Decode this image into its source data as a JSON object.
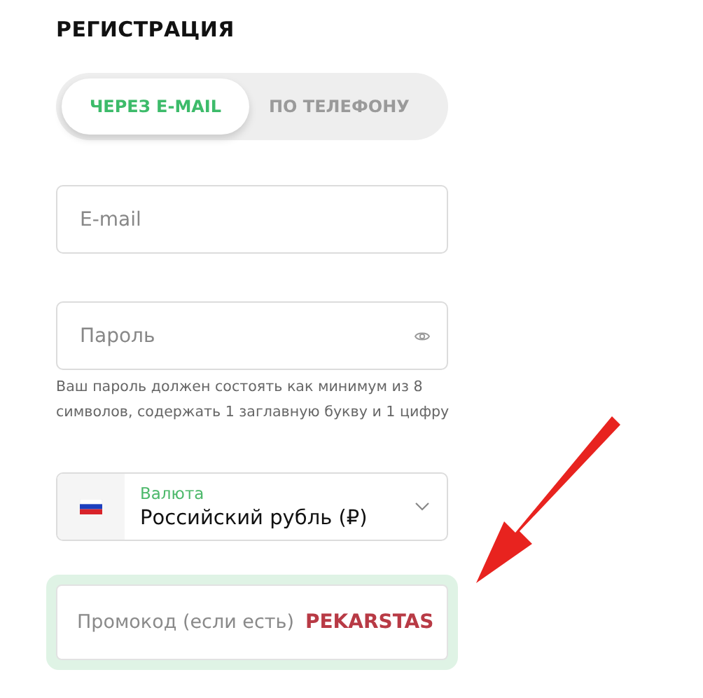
{
  "title": "РЕГИСТРАЦИЯ",
  "tabs": [
    {
      "label": "ЧЕРЕЗ E-MAIL",
      "selected": true
    },
    {
      "label": "ПО ТЕЛЕФОНУ",
      "selected": false
    }
  ],
  "email": {
    "placeholder": "E-mail"
  },
  "password": {
    "placeholder": "Пароль",
    "hint": "Ваш пароль должен состоять как минимум из 8 символов, содержать 1 заглавную букву и 1 цифру"
  },
  "currency": {
    "label": "Валюта",
    "value": "Российский рубль (₽)"
  },
  "promo": {
    "label": "Промокод (если есть)",
    "value": "PEKARSTAS"
  },
  "annotations": [
    {
      "kind": "arrow"
    }
  ]
}
